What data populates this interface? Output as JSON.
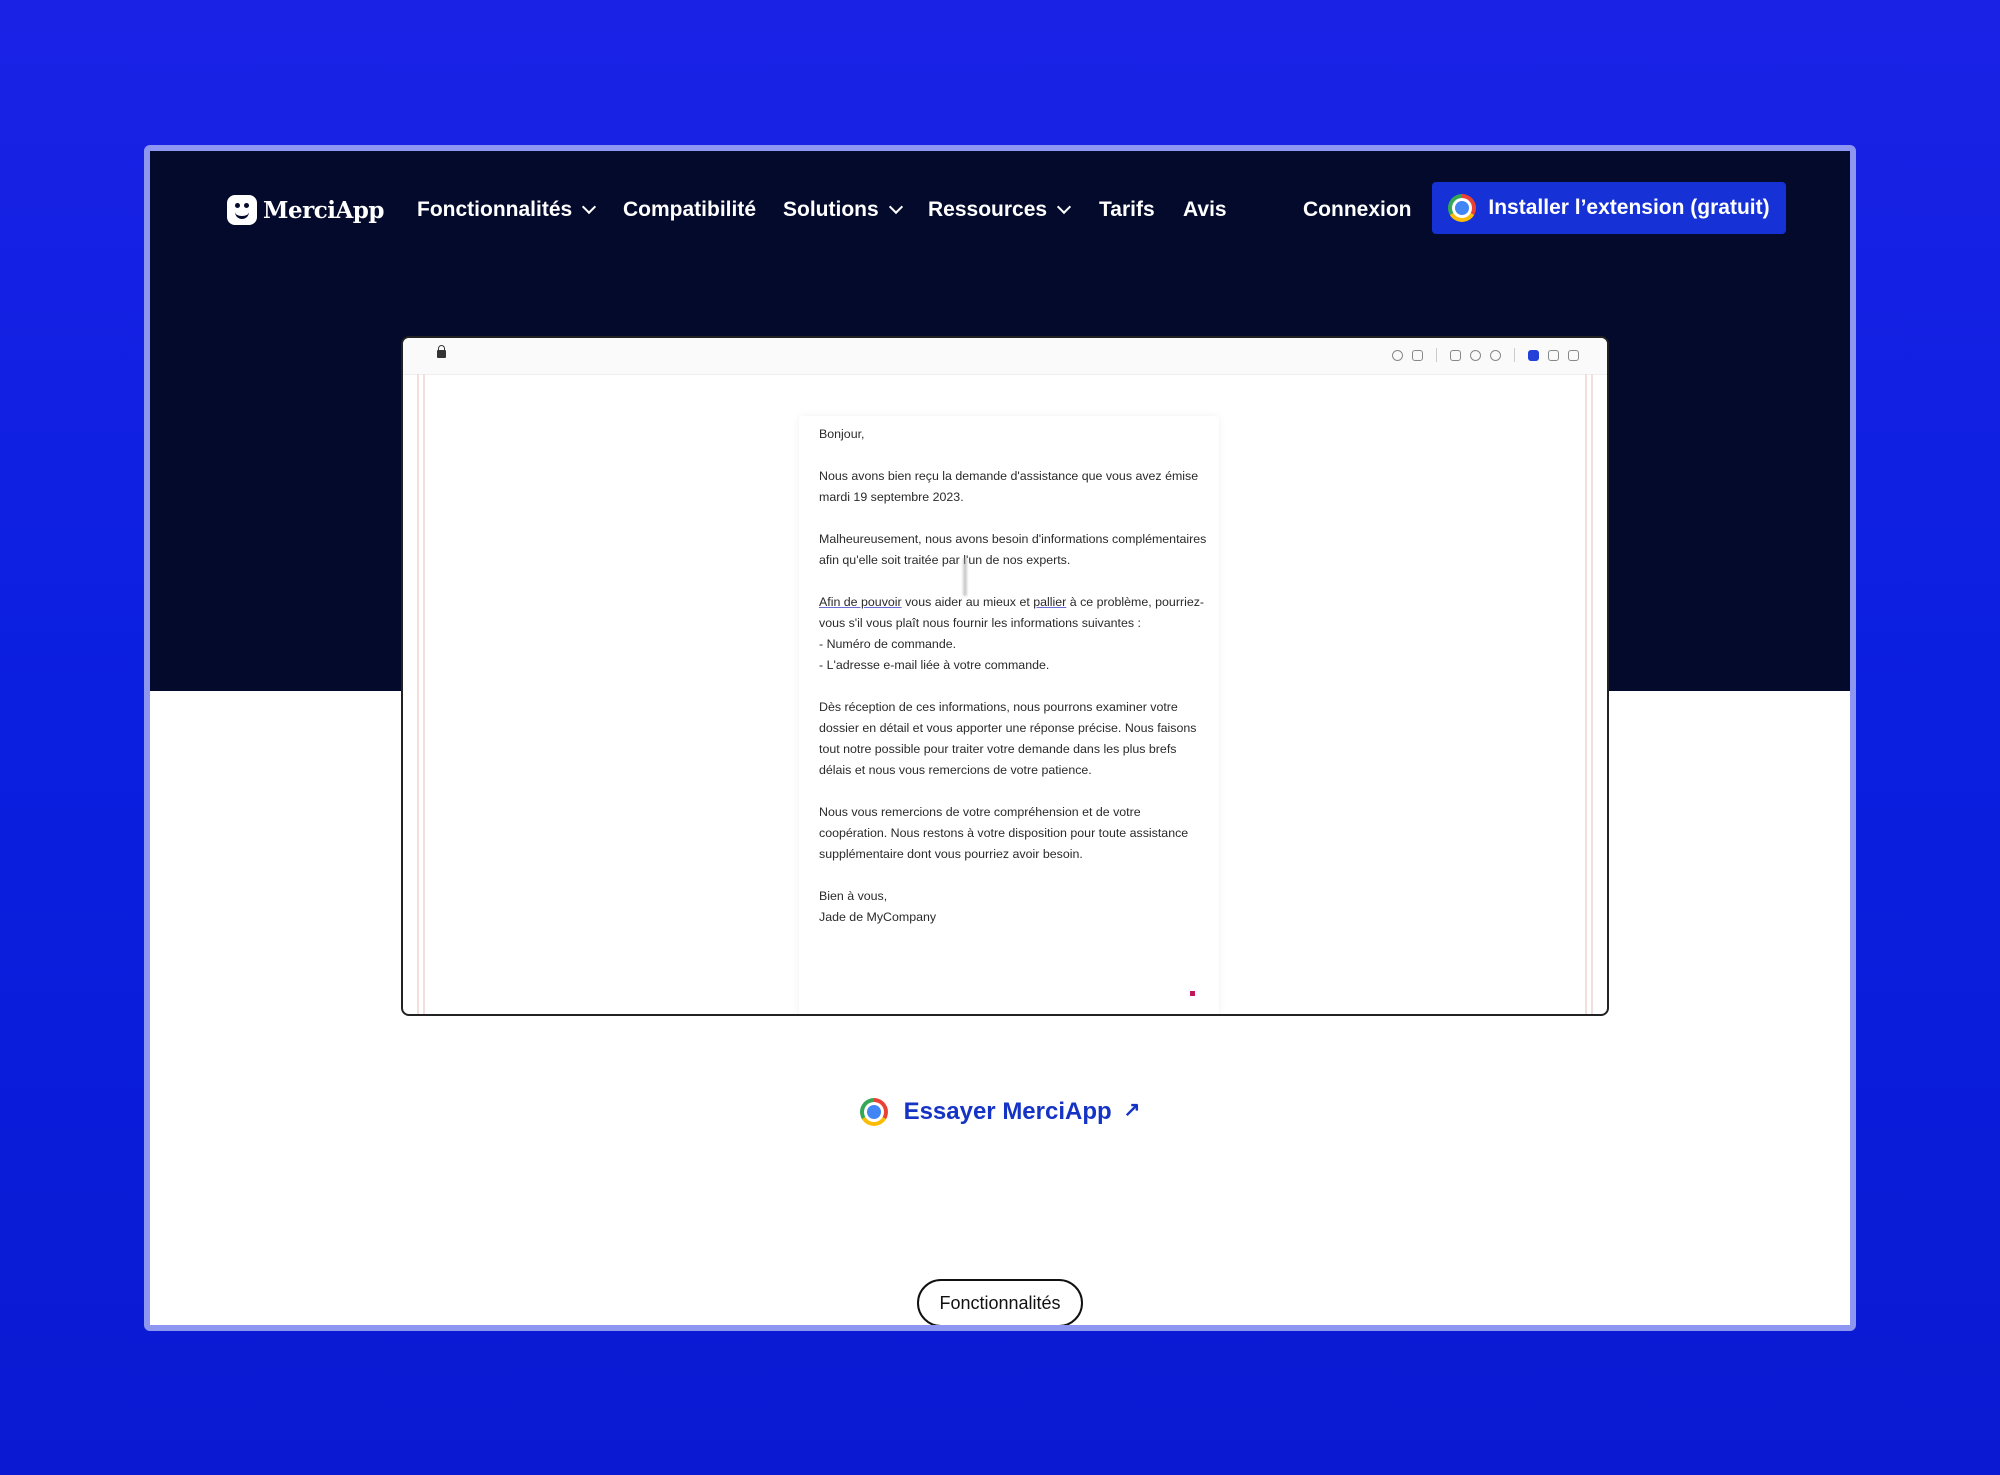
{
  "brand": {
    "name": "MerciApp"
  },
  "nav": {
    "items": [
      {
        "label": "Fonctionnalités",
        "has_dropdown": true
      },
      {
        "label": "Compatibilité",
        "has_dropdown": false
      },
      {
        "label": "Solutions",
        "has_dropdown": true
      },
      {
        "label": "Ressources",
        "has_dropdown": true
      },
      {
        "label": "Tarifs",
        "has_dropdown": false
      },
      {
        "label": "Avis",
        "has_dropdown": false
      }
    ],
    "login_label": "Connexion",
    "install_label": "Installer l’extension (gratuit)"
  },
  "demo": {
    "email": {
      "greeting": "Bonjour,",
      "p1": "Nous avons bien reçu la demande d'assistance que vous avez émise mardi 19 septembre 2023.",
      "p2": "Malheureusement, nous avons besoin d'informations complémentaires afin qu'elle soit traitée par l'un de nos experts.",
      "p3_link1": "Afin de pouvoir",
      "p3_mid": " vous aider au mieux et ",
      "p3_link2": "pallier",
      "p3_rest": " à ce problème, pourriez-vous s'il vous plaît nous fournir les informations suivantes :",
      "list1": "- Numéro de commande.",
      "list2": "- L'adresse e-mail liée à votre commande.",
      "p4": "Dès réception de ces informations, nous pourrons examiner votre dossier en détail et vous apporter une réponse précise. Nous faisons tout notre possible pour traiter votre demande dans les plus brefs délais et nous vous remercions de votre patience.",
      "p5": "Nous vous remercions de votre compréhension et de votre coopération. Nous restons à votre disposition pour toute assistance supplémentaire dont vous pourriez avoir besoin.",
      "closing": "Bien à vous,",
      "signature": "Jade de MyCompany"
    }
  },
  "cta": {
    "label": "Essayer MerciApp",
    "arrow": "↗"
  },
  "section_pill": {
    "label": "Fonctionnalités"
  },
  "colors": {
    "accent": "#1631d6",
    "hero_bg": "#040a2c",
    "page_bg": "#0a1fe0"
  }
}
